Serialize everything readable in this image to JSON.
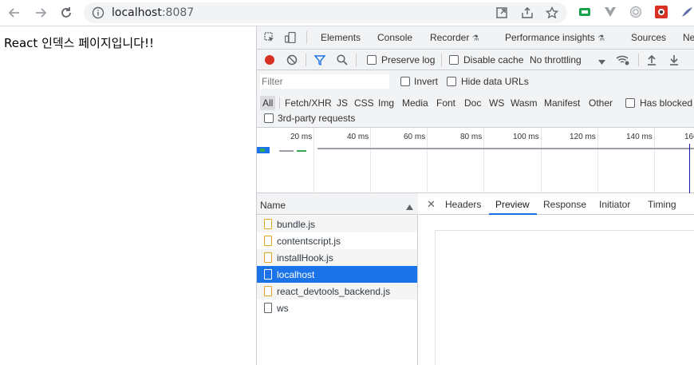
{
  "browser": {
    "url_host": "localhost",
    "url_port": ":8087"
  },
  "page": {
    "text": "React 인덱스 페이지입니다!!"
  },
  "devtools": {
    "tabs": [
      "Elements",
      "Console",
      "Recorder",
      "Performance insights",
      "Sources",
      "Ne"
    ],
    "network_toolbar": {
      "preserve_log": "Preserve log",
      "disable_cache": "Disable cache",
      "throttling": "No throttling"
    },
    "filter": {
      "placeholder": "Filter",
      "invert": "Invert",
      "hide_data_urls": "Hide data URLs",
      "types": [
        "All",
        "Fetch/XHR",
        "JS",
        "CSS",
        "Img",
        "Media",
        "Font",
        "Doc",
        "WS",
        "Wasm",
        "Manifest",
        "Other"
      ],
      "has_blocked": "Has blocked c",
      "third_party": "3rd-party requests"
    },
    "timeline": {
      "ticks": [
        "20 ms",
        "40 ms",
        "60 ms",
        "80 ms",
        "100 ms",
        "120 ms",
        "140 ms",
        "160"
      ]
    },
    "requests": {
      "header": "Name",
      "items": [
        {
          "name": "bundle.js",
          "type": "script"
        },
        {
          "name": "contentscript.js",
          "type": "script"
        },
        {
          "name": "installHook.js",
          "type": "script"
        },
        {
          "name": "localhost",
          "type": "document"
        },
        {
          "name": "react_devtools_backend.js",
          "type": "script"
        },
        {
          "name": "ws",
          "type": "websocket"
        }
      ]
    },
    "detail_tabs": [
      "Headers",
      "Preview",
      "Response",
      "Initiator",
      "Timing"
    ],
    "detail_active": "Preview",
    "colors": {
      "selected": "#1a73e8",
      "record": "#d93025",
      "script_icon": "#e3a623"
    }
  }
}
